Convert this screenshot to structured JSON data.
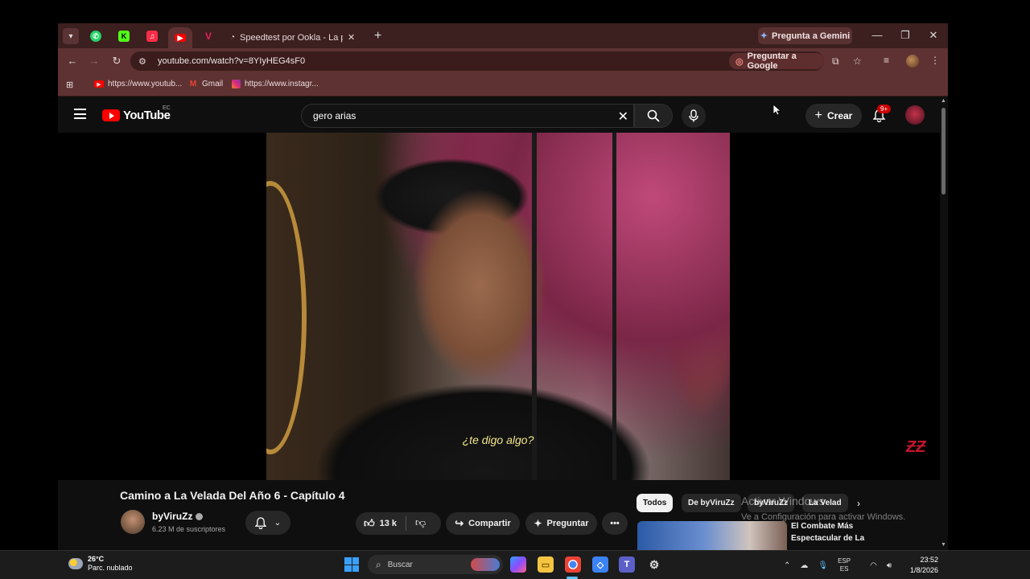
{
  "browser": {
    "tab_title": "Speedtest por Ookla - La prueba",
    "gemini_label": "Pregunta a Gemini",
    "url": "youtube.com/watch?v=8YIyHEG4sF0",
    "ask_google_label": "Preguntar a Google",
    "bookmarks": [
      {
        "label": "https://www.youtub...",
        "icon": "youtube-icon"
      },
      {
        "label": "Gmail",
        "icon": "gmail-icon"
      },
      {
        "label": "https://www.instagr...",
        "icon": "instagram-icon"
      }
    ],
    "accent_color": "#5e3232"
  },
  "youtube": {
    "logo_text": "YouTube",
    "country_code": "EC",
    "search_value": "gero arias",
    "create_label": "Crear",
    "notification_badge": "9+",
    "subtitle": "¿te digo algo?",
    "video_title": "Camino a La Velada Del Año 6 - Capítulo 4",
    "channel_name": "byViruZz",
    "subscribers": "6.23 M de suscriptores",
    "likes": "13 k",
    "share_label": "Compartir",
    "ask_label": "Preguntar",
    "chips": [
      "Todos",
      "De byViruZz",
      "byViruZz",
      "La Velad"
    ],
    "related_title": "El Combate Más Espectacular de La",
    "watermark": "Activar Windows",
    "watermark_sub": "Ve a Configuración para activar Windows.",
    "brand_color": "#ff0000"
  },
  "taskbar": {
    "weather_temp": "26°C",
    "weather_desc": "Parc. nublado",
    "search_placeholder": "Buscar",
    "lang_primary": "ESP",
    "lang_secondary": "ES",
    "time": "23:52",
    "date": "1/8/2026"
  }
}
